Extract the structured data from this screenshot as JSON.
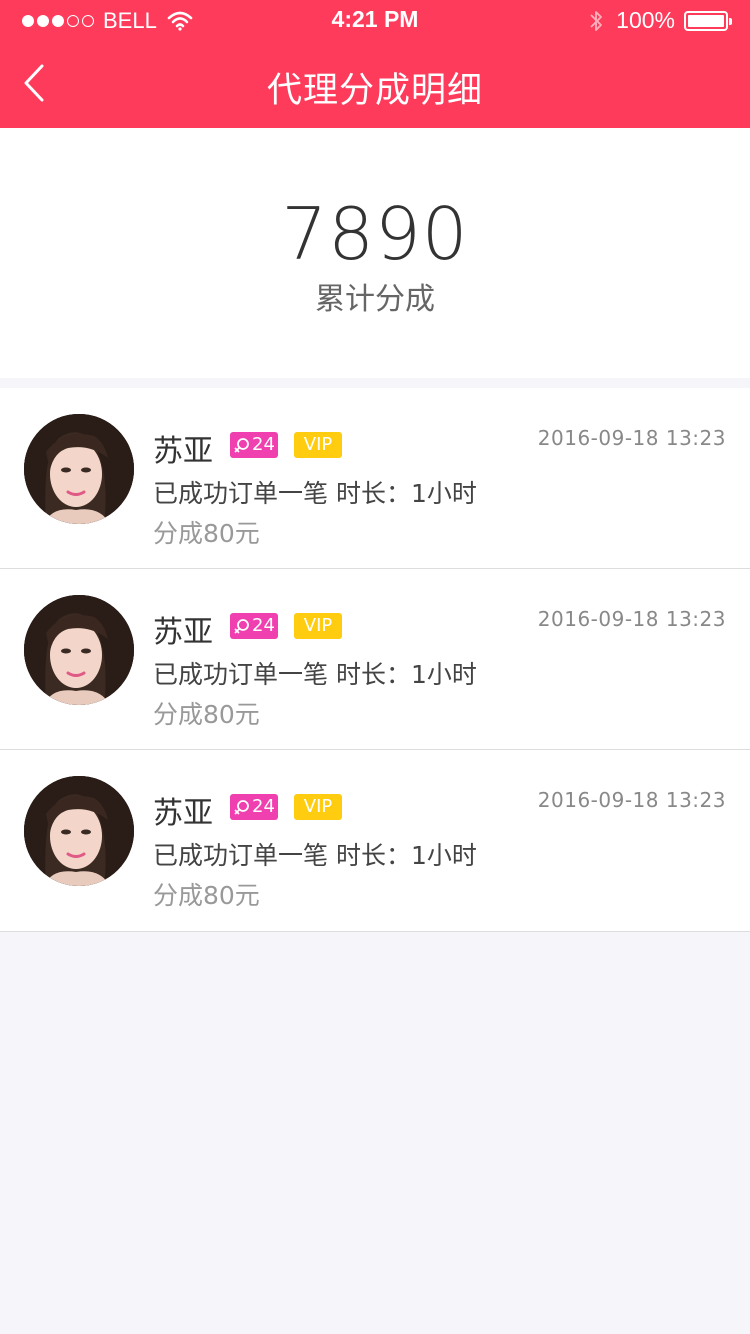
{
  "status_bar": {
    "carrier": "BELL",
    "time": "4:21 PM",
    "battery": "100%"
  },
  "nav": {
    "title": "代理分成明细"
  },
  "summary": {
    "value": "7890",
    "label": "累计分成"
  },
  "colors": {
    "brand": "#ff3b5c",
    "age_badge": "#f040b0",
    "vip_badge": "#ffcc10"
  },
  "records": [
    {
      "name": "苏亚",
      "age": "24",
      "vip": "VIP",
      "datetime": "2016-09-18   13:23",
      "desc": "已成功订单一笔   时长：1小时",
      "share": "分成80元"
    },
    {
      "name": "苏亚",
      "age": "24",
      "vip": "VIP",
      "datetime": "2016-09-18   13:23",
      "desc": "已成功订单一笔   时长：1小时",
      "share": "分成80元"
    },
    {
      "name": "苏亚",
      "age": "24",
      "vip": "VIP",
      "datetime": "2016-09-18   13:23",
      "desc": "已成功订单一笔   时长：1小时",
      "share": "分成80元"
    }
  ]
}
